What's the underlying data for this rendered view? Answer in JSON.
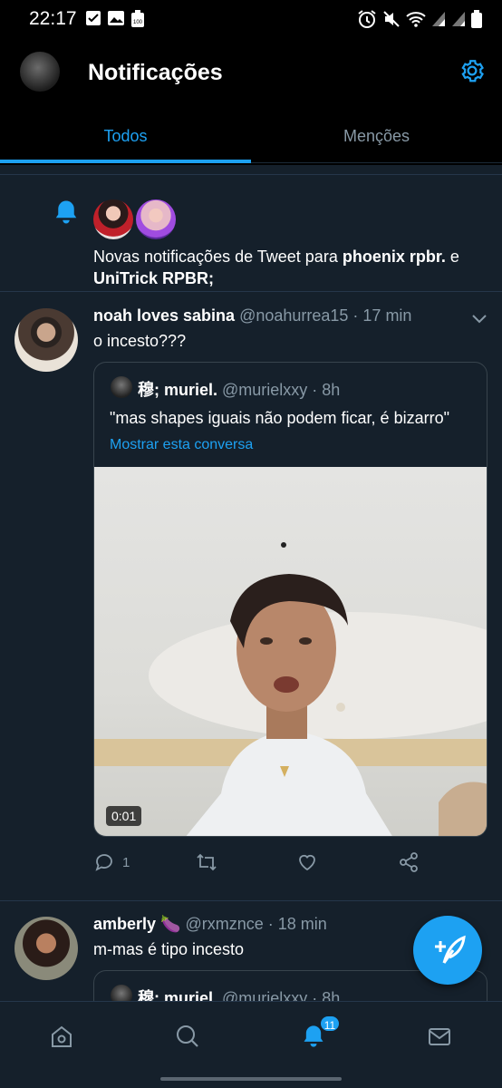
{
  "status_bar": {
    "time": "22:17",
    "battery_label": "100"
  },
  "header": {
    "title": "Notificações"
  },
  "tabs": [
    {
      "label": "Todos"
    },
    {
      "label": "Menções"
    }
  ],
  "notification": {
    "prefix": "Novas notificações de Tweet para ",
    "name1": "phoenix rpbr.",
    "connector": " e ",
    "name2": "UniTrick RPBR;"
  },
  "tweets": [
    {
      "name": "noah loves sabina",
      "meta": " @noahurrea15 · 17 min",
      "text": "o incesto???",
      "quote": {
        "name": "穆; muriel.",
        "meta": " @murielxxy · 8h",
        "text": "\"mas shapes iguais não podem ficar, é bizarro\"",
        "link": "Mostrar esta conversa",
        "video_duration": "0:01"
      },
      "replies": "1"
    },
    {
      "name": "amberly",
      "emoji": "🍆",
      "meta": " @rxmznce · 18 min",
      "text": "m-mas é tipo incesto",
      "quote": {
        "name": "穆; muriel.",
        "meta": " @murielxxy · 8h"
      }
    }
  ],
  "bottom_nav": {
    "notif_badge": "11"
  },
  "colors": {
    "accent": "#1da1f2",
    "background": "#15202b",
    "header": "#000000",
    "muted": "#8899a6"
  },
  "icons": [
    "checkbox-icon",
    "gallery-icon",
    "battery-icon",
    "alarm-icon",
    "mute-icon",
    "wifi-icon",
    "signal-icon",
    "gear-icon",
    "bell-icon",
    "chevron-down-icon",
    "reply-icon",
    "retweet-icon",
    "like-icon",
    "share-icon",
    "compose-icon",
    "home-icon",
    "search-icon",
    "mail-icon"
  ]
}
